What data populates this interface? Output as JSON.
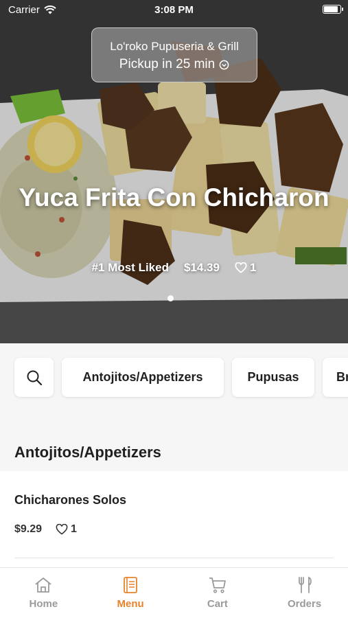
{
  "status_bar": {
    "carrier": "Carrier",
    "time": "3:08 PM",
    "battery_level": 0.9
  },
  "pickup": {
    "restaurant": "Lo'roko Pupuseria & Grill",
    "label": "Pickup in 25 min"
  },
  "featured": {
    "title": "Yuca Frita Con Chicharon",
    "badge": "#1 Most Liked",
    "price": "$14.39",
    "likes": "1",
    "page_count": 1,
    "current_page": 1
  },
  "categories": [
    {
      "label": "Antojitos/Appetizers"
    },
    {
      "label": "Pupusas"
    },
    {
      "label": "Br"
    }
  ],
  "section": {
    "title": "Antojitos/Appetizers"
  },
  "menu_items": [
    {
      "name": "Chicharones Solos",
      "price": "$9.29",
      "likes": "1"
    }
  ],
  "tabs": [
    {
      "label": "Home",
      "icon": "home-icon",
      "active": false
    },
    {
      "label": "Menu",
      "icon": "menu-book-icon",
      "active": true
    },
    {
      "label": "Cart",
      "icon": "cart-icon",
      "active": false
    },
    {
      "label": "Orders",
      "icon": "fork-knife-icon",
      "active": false
    }
  ],
  "colors": {
    "accent": "#e8822a",
    "inactive_tab": "#9a9a9a",
    "text": "#1f1f1f"
  }
}
